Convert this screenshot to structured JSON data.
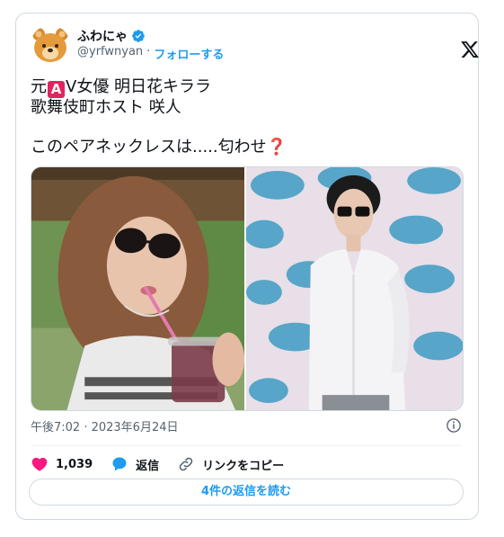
{
  "user": {
    "display_name": "ふわにゃ",
    "handle": "@yrfwnyan",
    "separator": "·",
    "follow_label": "フォローする"
  },
  "tweet": {
    "line1_prefix": "元",
    "line1_badge": "A",
    "line1_suffix": "V女優 明日花キララ",
    "line2": "歌舞伎町ホスト 咲人",
    "line3": "このペアネックレスは.....匂わせ",
    "line3_emoji": "❓"
  },
  "timestamp": "午後7:02 · 2023年6月24日",
  "actions": {
    "likes": "1,039",
    "reply_label": "返信",
    "copy_link_label": "リンクをコピー"
  },
  "read_replies_label": "4件の返信を読む",
  "colors": {
    "accent": "#1d9bf0",
    "like": "#f91880",
    "badge_red": "#e0245e",
    "border": "#cfd9de"
  },
  "icons": [
    "bear-avatar",
    "verified-badge-icon",
    "x-logo-icon",
    "info-icon",
    "heart-icon",
    "reply-icon",
    "link-icon"
  ]
}
